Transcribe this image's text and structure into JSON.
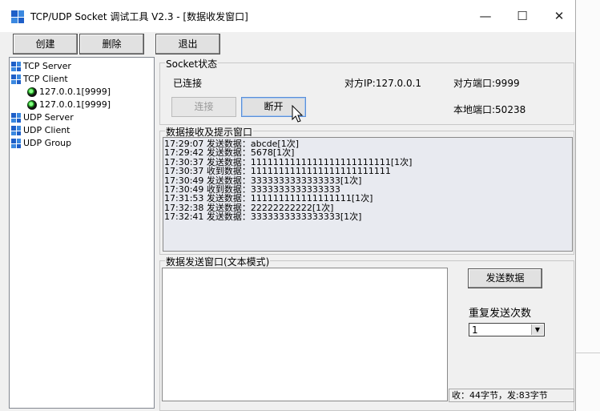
{
  "window": {
    "title": "TCP/UDP Socket 调试工具 V2.3 - [数据收发窗口]",
    "minimize_symbol": "—",
    "maximize_symbol": "☐",
    "close_symbol": "✕"
  },
  "toolbar": {
    "create_label": "创建",
    "delete_label": "删除",
    "exit_label": "退出"
  },
  "tree": {
    "items": [
      {
        "label": "TCP Server",
        "icon": "grid-icon"
      },
      {
        "label": "TCP Client",
        "icon": "grid-icon"
      },
      {
        "label": "127.0.0.1[9999]",
        "icon": "connected-icon"
      },
      {
        "label": "127.0.0.1[9999]",
        "icon": "connected-icon"
      },
      {
        "label": "UDP Server",
        "icon": "grid-icon"
      },
      {
        "label": "UDP Client",
        "icon": "grid-icon"
      },
      {
        "label": "UDP Group",
        "icon": "grid-icon"
      }
    ]
  },
  "socket_status": {
    "group_label": "Socket状态",
    "state": "已连接",
    "remote_ip": "对方IP:127.0.0.1",
    "remote_port": "对方端口:9999",
    "local_port": "本地端口:50238",
    "connect_label": "连接",
    "disconnect_label": "断开"
  },
  "receive": {
    "group_label": "数据接收及提示窗口",
    "lines": [
      "17:29:07 发送数据：abcde[1次]",
      "17:29:42 发送数据：5678[1次]",
      "17:30:37 发送数据：1111111111111111111111111[1次]",
      "17:30:37 收到数据：1111111111111111111111111",
      "17:30:49 发送数据：3333333333333333[1次]",
      "17:30:49 收到数据：3333333333333333",
      "17:31:53 发送数据：111111111111111111[1次]",
      "17:32:38 发送数据：22222222222[1次]",
      "17:32:41 发送数据：3333333333333333[1次]"
    ]
  },
  "send": {
    "group_label": "数据发送窗口(文本模式)",
    "send_button_label": "发送数据",
    "repeat_label": "重复发送次数",
    "repeat_value": "1",
    "stats": "收：44字节，发:83字节"
  },
  "colors": {
    "accent_blue": "#1e5fc8",
    "log_background": "#e8eaf0"
  }
}
